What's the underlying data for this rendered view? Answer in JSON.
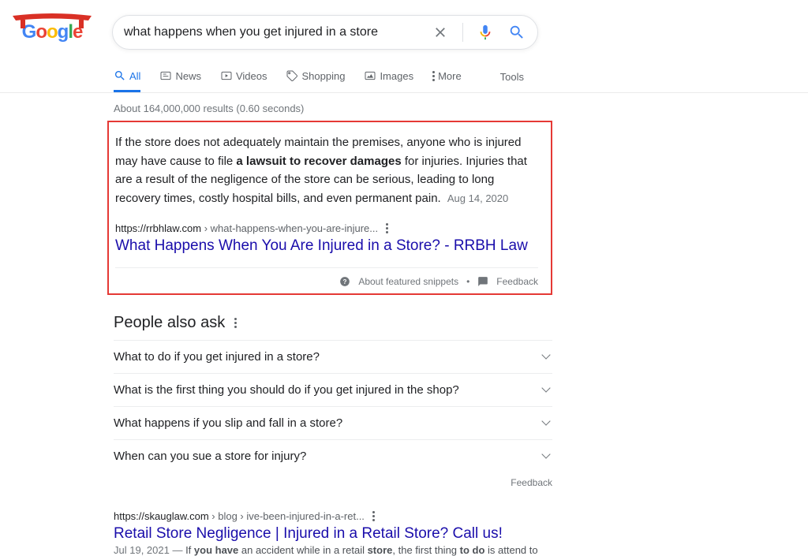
{
  "search": {
    "query": "what happens when you get injured in a store"
  },
  "tabs": {
    "all": "All",
    "news": "News",
    "videos": "Videos",
    "shopping": "Shopping",
    "images": "Images",
    "more": "More",
    "tools": "Tools"
  },
  "result_stats": "About 164,000,000 results (0.60 seconds)",
  "featured": {
    "text_pre": "If the store does not adequately maintain the premises, anyone who is injured may have cause to file ",
    "text_bold": "a lawsuit to recover damages",
    "text_post": " for injuries. Injuries that are a result of the negligence of the store can be serious, leading to long recovery times, costly hospital bills, and even permanent pain.",
    "date": "Aug 14, 2020",
    "url_domain": "https://rrbhlaw.com",
    "url_path": " › what-happens-when-you-are-injure...",
    "title": "What Happens When You Are Injured in a Store? - RRBH Law",
    "about_label": "About featured snippets",
    "feedback_label": "Feedback"
  },
  "paa": {
    "title": "People also ask",
    "items": [
      "What to do if you get injured in a store?",
      "What is the first thing you should do if you get injured in the shop?",
      "What happens if you slip and fall in a store?",
      "When can you sue a store for injury?"
    ],
    "feedback": "Feedback"
  },
  "result1": {
    "url_domain": "https://skauglaw.com",
    "url_path": " › blog › ive-been-injured-in-a-ret...",
    "title": "Retail Store Negligence | Injured in a Retail Store? Call us!",
    "snip_date": "Jul 19, 2021 — ",
    "snip_pre": "If ",
    "snip_b1": "you have",
    "snip_mid": " an accident while in a retail ",
    "snip_b2": "store",
    "snip_post": ", the first thing ",
    "snip_b3": "to do",
    "snip_end": " is attend to"
  }
}
